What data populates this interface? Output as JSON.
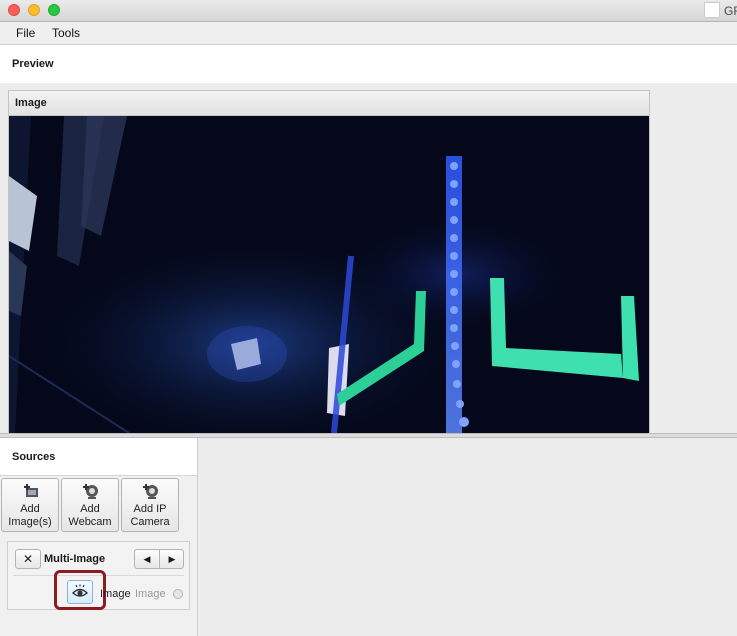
{
  "window": {
    "title": "GR"
  },
  "menu": {
    "items": [
      "File",
      "Tools"
    ]
  },
  "preview": {
    "title": "Preview",
    "panel_title": "Image"
  },
  "sources": {
    "title": "Sources",
    "add_buttons": [
      {
        "line1": "Add",
        "line2": "Image(s)",
        "icon": "add-image-icon"
      },
      {
        "line1": "Add",
        "line2": "Webcam",
        "icon": "add-webcam-icon"
      },
      {
        "line1": "Add IP",
        "line2": "Camera",
        "icon": "add-ip-camera-icon"
      }
    ],
    "card": {
      "remove_label": "✕",
      "name": "Multi-Image",
      "prev_label": "◀",
      "next_label": "▶",
      "socket_name": "Image",
      "socket_type": "Image",
      "preview_icon": "eye-icon"
    }
  },
  "colors": {
    "highlight": "#8c1c24",
    "led_strip": "#3a6cff",
    "target_tape": "#3fe0b0"
  }
}
